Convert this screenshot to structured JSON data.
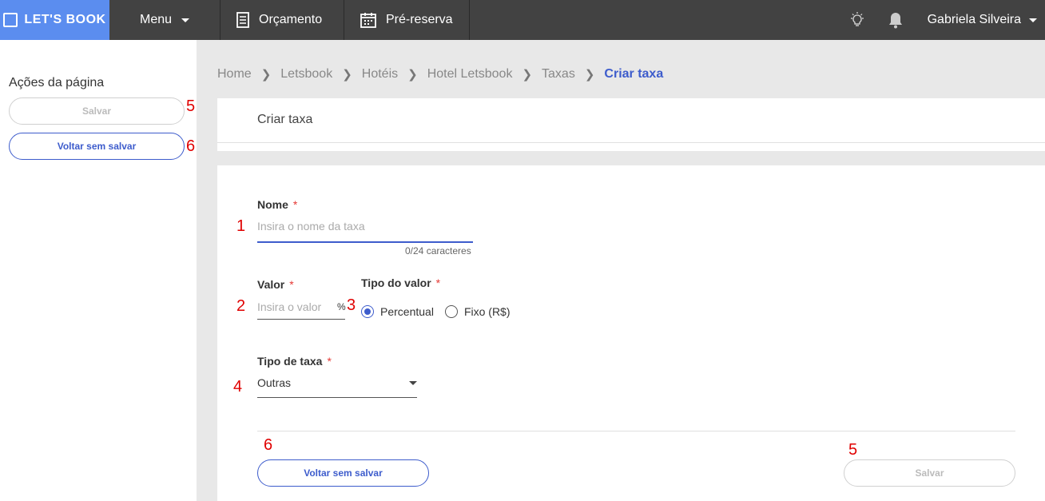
{
  "topbar": {
    "logo_text": "LET'S BOOK",
    "menu_label": "Menu",
    "orcamento_label": "Orçamento",
    "prereserva_label": "Pré-reserva",
    "user_name": "Gabriela Silveira",
    "icons": [
      "logo-icon",
      "document-icon",
      "calendar-icon",
      "lightbulb-icon",
      "bell-icon"
    ]
  },
  "sidebar": {
    "title": "Ações da página",
    "save_label": "Salvar",
    "back_label": "Voltar sem salvar"
  },
  "breadcrumb": [
    "Home",
    "Letsbook",
    "Hotéis",
    "Hotel Letsbook",
    "Taxas",
    "Criar taxa"
  ],
  "header": {
    "title": "Criar taxa"
  },
  "form": {
    "nome_label": "Nome",
    "nome_placeholder": "Insira o nome da taxa",
    "nome_counter": "0/24 caracteres",
    "valor_label": "Valor",
    "valor_placeholder": "Insira o valor",
    "valor_suffix": "%",
    "tipo_valor_label": "Tipo do valor",
    "tipo_valor_options": [
      "Percentual",
      "Fixo (R$)"
    ],
    "tipo_valor_selected": "Percentual",
    "tipo_taxa_label": "Tipo de taxa",
    "tipo_taxa_value": "Outras",
    "required_mark": "*",
    "back_label": "Voltar sem salvar",
    "save_label": "Salvar"
  },
  "annotations": [
    "1",
    "2",
    "3",
    "4",
    "5",
    "6"
  ],
  "colors": {
    "topbar": "#424242",
    "logo": "#5b8def",
    "accent": "#3d5ccc",
    "required": "#e53935",
    "annotation": "#e00000"
  }
}
